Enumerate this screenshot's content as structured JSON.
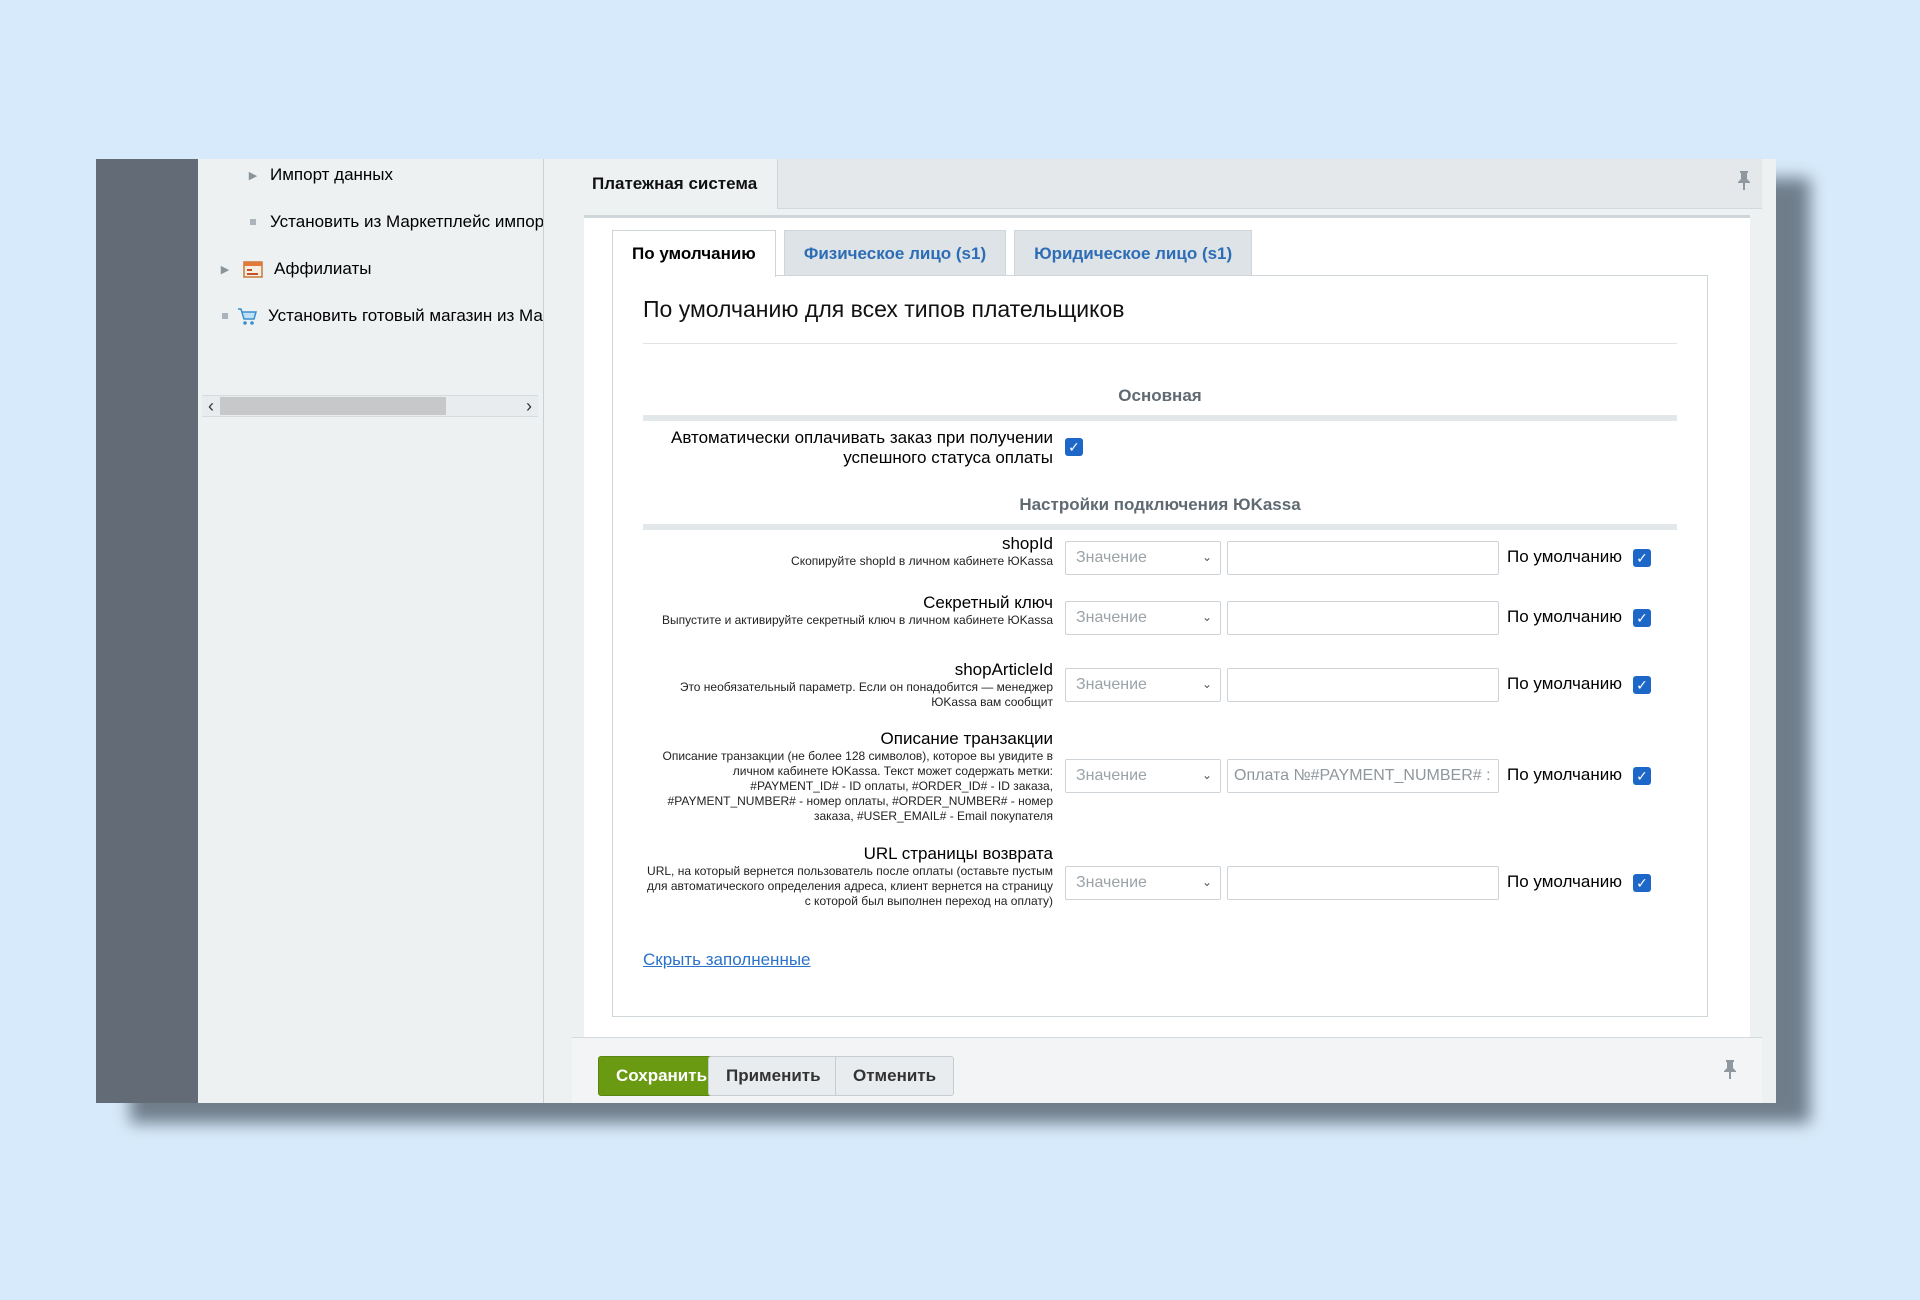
{
  "tree": {
    "items": [
      {
        "label": "Импорт данных",
        "marker": "arrow",
        "icon": ""
      },
      {
        "label": "Установить из Маркетплейс импор",
        "marker": "bullet",
        "icon": ""
      },
      {
        "label": "Аффилиаты",
        "marker": "arrow",
        "icon": "affiliate-icon"
      },
      {
        "label": "Установить готовый магазин из Ма",
        "marker": "bullet",
        "icon": "cart-icon"
      }
    ]
  },
  "header": {
    "title": "Платежная система"
  },
  "tabs": [
    {
      "label": "По умолчанию",
      "active": true
    },
    {
      "label": "Физическое лицо (s1)",
      "active": false
    },
    {
      "label": "Юридическое лицо (s1)",
      "active": false
    }
  ],
  "section": {
    "title": "По умолчанию для всех типов плательщиков"
  },
  "groups": {
    "main": "Основная",
    "yookassa": "Настройки подключения ЮKassa"
  },
  "auto_pay": {
    "label": "Автоматически оплачивать заказ при получении успешного статуса оплаты",
    "checked": true
  },
  "fields": [
    {
      "label": "shopId",
      "hint": "Скопируйте shopId в личном кабинете ЮKassa",
      "select": "Значение",
      "value": "",
      "placeholder": "",
      "default_label": "По умолчанию",
      "default_checked": true
    },
    {
      "label": "Секретный ключ",
      "hint": "Выпустите и активируйте секретный ключ в личном кабинете ЮKassa",
      "select": "Значение",
      "value": "",
      "placeholder": "",
      "default_label": "По умолчанию",
      "default_checked": true
    },
    {
      "label": "shopArticleId",
      "hint": "Это необязательный параметр. Если он понадобится — менеджер ЮKassa вам сообщит",
      "select": "Значение",
      "value": "",
      "placeholder": "",
      "default_label": "По умолчанию",
      "default_checked": true
    },
    {
      "label": "Описание транзакции",
      "hint": "Описание транзакции (не более 128 символов), которое вы увидите в личном кабинете ЮKassa. Текст может содержать метки: #PAYMENT_ID# - ID оплаты, #ORDER_ID# - ID заказа, #PAYMENT_NUMBER# - номер оплаты, #ORDER_NUMBER# - номер заказа, #USER_EMAIL# - Email покупателя",
      "select": "Значение",
      "value": "",
      "placeholder": "Оплата №#PAYMENT_NUMBER# :",
      "default_label": "По умолчанию",
      "default_checked": true
    },
    {
      "label": "URL страницы возврата",
      "hint": "URL, на который вернется пользователь после оплаты (оставьте пустым для автоматического определения адреса, клиент вернется на страницу с которой был выполнен переход на оплату)",
      "select": "Значение",
      "value": "",
      "placeholder": "",
      "default_label": "По умолчанию",
      "default_checked": true
    }
  ],
  "links": {
    "hide_filled": "Скрыть заполненные"
  },
  "buttons": {
    "save": "Сохранить",
    "apply": "Применить",
    "cancel": "Отменить"
  },
  "colors": {
    "accent": "#1c67c7",
    "save": "#6a9a12",
    "link": "#2b73c9"
  }
}
